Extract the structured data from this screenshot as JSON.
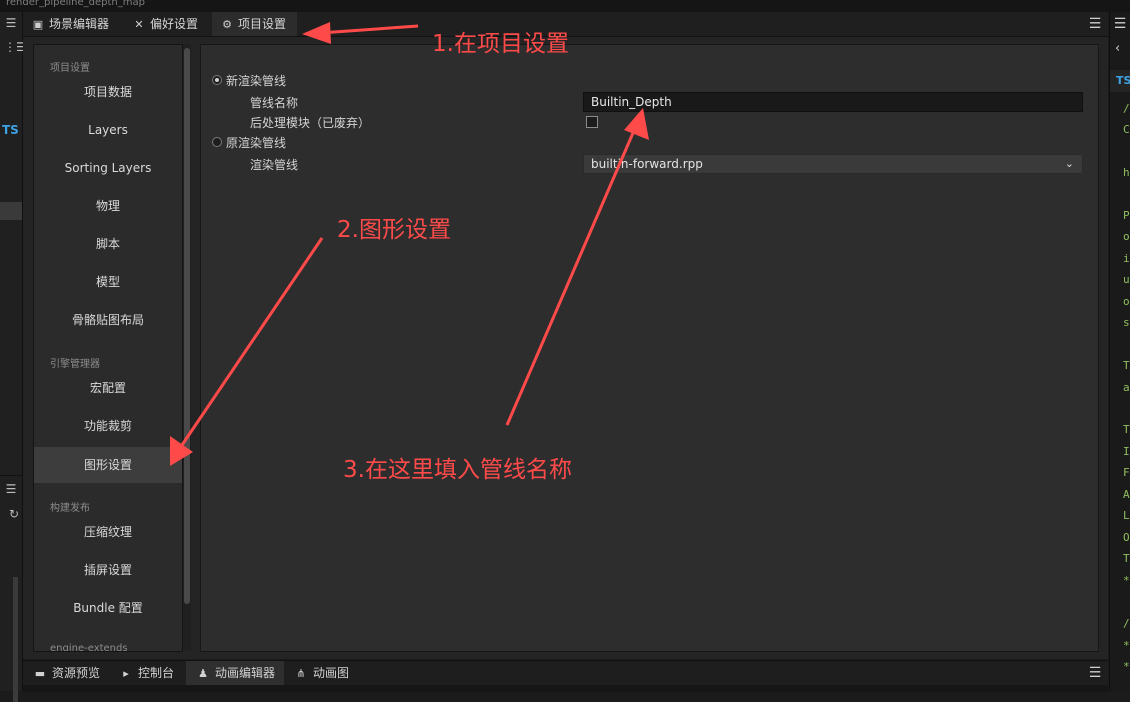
{
  "window_title": "render_pipeline_depth_map",
  "top_tabs": [
    {
      "label": "场景编辑器",
      "icon": "scene-icon"
    },
    {
      "label": "偏好设置",
      "icon": "tools-icon"
    },
    {
      "label": "项目设置",
      "icon": "gear-icon",
      "active": true
    }
  ],
  "sidebar": {
    "sections": [
      {
        "title": "项目设置",
        "items": [
          "项目数据",
          "Layers",
          "Sorting Layers",
          "物理",
          "脚本",
          "模型",
          "骨骼贴图布局"
        ]
      },
      {
        "title": "引擎管理器",
        "items": [
          "宏配置",
          "功能裁剪",
          "图形设置"
        ]
      },
      {
        "title": "构建发布",
        "items": [
          "压缩纹理",
          "插屏设置",
          "Bundle 配置"
        ]
      },
      {
        "title": "engine-extends",
        "items": []
      }
    ],
    "active_item": "图形设置"
  },
  "graphics": {
    "new_pipeline_label": "新渲染管线",
    "pipeline_name_label": "管线名称",
    "pipeline_name_value": "Builtin_Depth",
    "postprocess_label": "后处理模块（已废弃）",
    "postprocess_checked": false,
    "old_pipeline_label": "原渲染管线",
    "render_pipeline_label": "渲染管线",
    "render_pipeline_value": "builtin-forward.rpp",
    "selected_option": "new"
  },
  "bottom_tabs": [
    {
      "label": "资源预览",
      "icon": "folder-icon"
    },
    {
      "label": "控制台",
      "icon": "console-icon"
    },
    {
      "label": "动画编辑器",
      "icon": "running-icon",
      "active": true
    },
    {
      "label": "动画图",
      "icon": "graph-icon"
    }
  ],
  "left_panel": {
    "label": "TS"
  },
  "right_panel": {
    "label": "TS",
    "code_chars": [
      "/",
      "C",
      "h",
      "P",
      "o",
      "i",
      "u",
      "o",
      "s",
      "T",
      "a",
      "T",
      "I",
      "F",
      "A",
      "L",
      "O",
      "T",
      "*",
      "/",
      "*",
      "*"
    ]
  },
  "annotations": {
    "step1": "1.在项目设置",
    "step2": "2.图形设置",
    "step3": "3.在这里填入管线名称",
    "color": "#ff4a4a"
  }
}
